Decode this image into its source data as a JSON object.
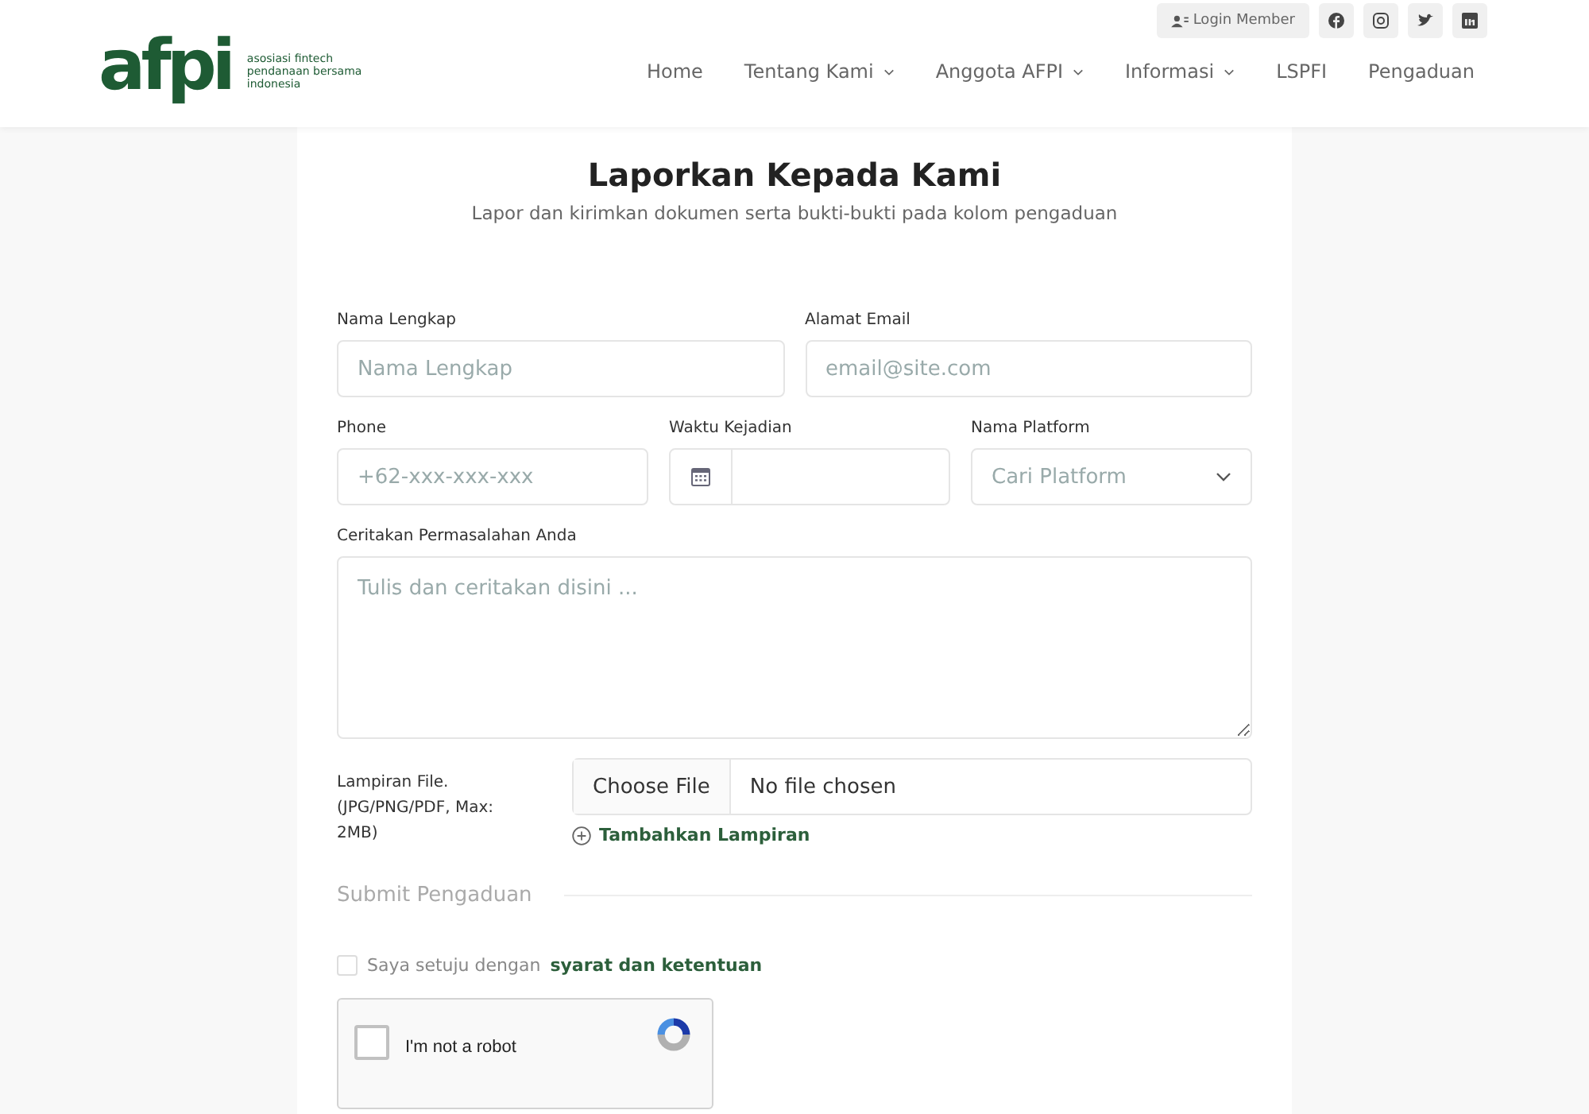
{
  "topbar": {
    "login": "Login Member",
    "social": [
      {
        "kind": "facebook"
      },
      {
        "kind": "instagram"
      },
      {
        "kind": "twitter"
      },
      {
        "kind": "linkedin"
      }
    ]
  },
  "logo": {
    "mark": "afpi",
    "tagline": [
      "asosiasi fintech",
      "pendanaan bersama",
      "indonesia"
    ]
  },
  "nav": [
    {
      "label": "Home",
      "dropdown": false
    },
    {
      "label": "Tentang Kami",
      "dropdown": true
    },
    {
      "label": "Anggota AFPI",
      "dropdown": true
    },
    {
      "label": "Informasi",
      "dropdown": true
    },
    {
      "label": "LSPFI",
      "dropdown": false
    },
    {
      "label": "Pengaduan",
      "dropdown": false
    }
  ],
  "form": {
    "title": "Laporkan Kepada Kami",
    "subtitle": "Lapor dan kirimkan dokumen serta bukti-bukti pada kolom pengaduan",
    "row1": [
      {
        "label": "Nama Lengkap",
        "kind": "text",
        "placeholder": "Nama Lengkap"
      },
      {
        "label": "Alamat Email",
        "kind": "text",
        "placeholder": "email@site.com"
      }
    ],
    "row2": [
      {
        "label": "Phone",
        "kind": "text",
        "placeholder": "+62-xxx-xxx-xxx"
      },
      {
        "label": "Waktu Kejadian",
        "kind": "date"
      },
      {
        "label": "Nama Platform",
        "kind": "select",
        "placeholder": "Cari Platform"
      }
    ],
    "story": {
      "label": "Ceritakan Permasalahan Anda",
      "placeholder": "Tulis dan ceritakan disini ..."
    },
    "file": {
      "label": "Lampiran File. (JPG/PNG/PDF, Max: 2MB)",
      "button": "Choose File",
      "status": "No file chosen"
    },
    "add_attachment": "Tambahkan Lampiran",
    "submit_heading": "Submit Pengaduan",
    "agree": {
      "text": "Saya setuju dengan",
      "link": "syarat dan ketentuan",
      "checked": false
    },
    "captcha": {
      "label": "I'm not a robot",
      "checked": false
    }
  }
}
